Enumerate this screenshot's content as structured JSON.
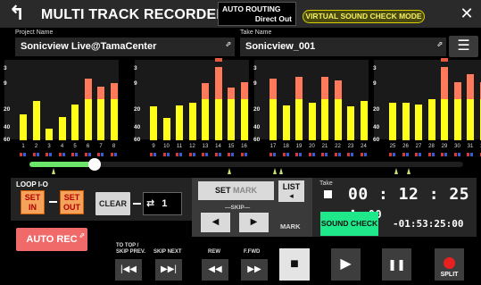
{
  "header": {
    "title": "MULTI TRACK RECORDER",
    "routing_label": "AUTO ROUTING",
    "routing_value": "Direct Out",
    "mode_badge": "VIRTUAL SOUND CHECK MODE"
  },
  "project": {
    "label": "Project Name",
    "value": "Sonicview Live@TamaCenter"
  },
  "take": {
    "label": "Take Name",
    "value": "Sonicview_001"
  },
  "meter": {
    "scale": [
      "3",
      "9",
      "20",
      "40",
      "60"
    ],
    "channels": [
      {
        "n": "1",
        "level": 0.34,
        "peak": false
      },
      {
        "n": "2",
        "level": 0.52,
        "peak": false
      },
      {
        "n": "3",
        "level": 0.16,
        "peak": false
      },
      {
        "n": "4",
        "level": 0.31,
        "peak": false
      },
      {
        "n": "5",
        "level": 0.48,
        "peak": false
      },
      {
        "n": "6",
        "level": 0.82,
        "peak": false
      },
      {
        "n": "7",
        "level": 0.72,
        "peak": false
      },
      {
        "n": "8",
        "level": 0.76,
        "peak": false
      },
      {
        "n": "9",
        "level": 0.45,
        "peak": false
      },
      {
        "n": "10",
        "level": 0.3,
        "peak": false
      },
      {
        "n": "11",
        "level": 0.46,
        "peak": false
      },
      {
        "n": "12",
        "level": 0.5,
        "peak": false
      },
      {
        "n": "13",
        "level": 0.76,
        "peak": false
      },
      {
        "n": "14",
        "level": 0.98,
        "peak": true
      },
      {
        "n": "15",
        "level": 0.7,
        "peak": false
      },
      {
        "n": "16",
        "level": 0.78,
        "peak": false
      },
      {
        "n": "17",
        "level": 0.82,
        "peak": false
      },
      {
        "n": "18",
        "level": 0.46,
        "peak": false
      },
      {
        "n": "19",
        "level": 0.84,
        "peak": false
      },
      {
        "n": "20",
        "level": 0.5,
        "peak": false
      },
      {
        "n": "21",
        "level": 0.84,
        "peak": false
      },
      {
        "n": "22",
        "level": 0.8,
        "peak": false
      },
      {
        "n": "23",
        "level": 0.45,
        "peak": false
      },
      {
        "n": "24",
        "level": 0.52,
        "peak": false
      },
      {
        "n": "25",
        "level": 0.5,
        "peak": false
      },
      {
        "n": "26",
        "level": 0.5,
        "peak": false
      },
      {
        "n": "27",
        "level": 0.48,
        "peak": false
      },
      {
        "n": "28",
        "level": 0.55,
        "peak": false
      },
      {
        "n": "29",
        "level": 0.98,
        "peak": true
      },
      {
        "n": "30",
        "level": 0.78,
        "peak": false
      },
      {
        "n": "31",
        "level": 0.88,
        "peak": false
      },
      {
        "n": "32",
        "level": 0.78,
        "peak": false
      }
    ],
    "colors": {
      "yellow": "#ffff1a",
      "red": "#ff7a5a",
      "peak": "#e65a3c",
      "dot_blue": "#3a5bd8",
      "dot_red": "#d83a3a"
    }
  },
  "position": {
    "progress": 0.15,
    "markers": [
      0.055,
      0.46,
      0.565,
      0.58,
      0.845,
      0.875
    ]
  },
  "loop": {
    "label": "LOOP I-O",
    "set_in": "SET\nIN",
    "set_out": "SET\nOUT",
    "clear": "CLEAR",
    "repeat_count": "1",
    "repeat_icon": "⇄"
  },
  "auto_rec": {
    "label": "AUTO REC"
  },
  "mark": {
    "set_mark": "SET",
    "set_mark_suffix": "MARK",
    "list": "LIST",
    "list_arrow": "◂",
    "skip": "SKIP",
    "label": "MARK",
    "prev_icon": "◀",
    "next_icon": "▶"
  },
  "time": {
    "take_label": "Take",
    "main": "00 : 12 : 25 :",
    "frames": "00",
    "remaining": "-01:53:25:00",
    "sound_check": "SOUND CHECK"
  },
  "transport": {
    "to_top": "TO TOP / SKIP PREV.",
    "skip_next": "SKIP NEXT",
    "rew": "REW",
    "ffwd": "F.FWD",
    "split": "SPLIT",
    "to_top_icon": "|◀◀",
    "skip_next_icon": "▶▶|",
    "rew_icon": "◀◀",
    "ffwd_icon": "▶▶",
    "stop_icon": "■",
    "play_icon": "▶",
    "pause_icon": "❚❚"
  },
  "icons": {
    "back": "back-arrow-icon",
    "close": "close-icon",
    "menu": "menu-icon",
    "external": "external-link-icon"
  }
}
